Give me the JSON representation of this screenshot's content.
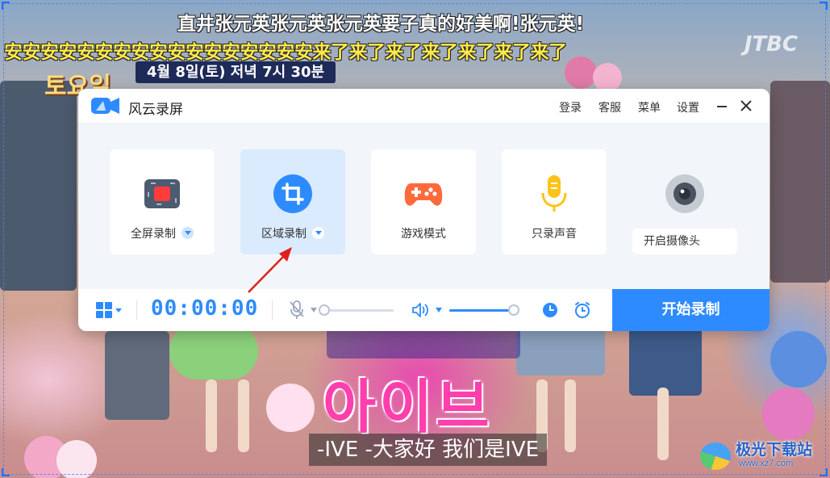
{
  "app": {
    "title": "风云录屏",
    "menu": {
      "login": "登录",
      "service": "客服",
      "menu": "菜单",
      "settings": "设置"
    },
    "modes": [
      {
        "label": "全屏录制",
        "icon": "fullscreen-record-icon",
        "has_dropdown": true,
        "selected": false
      },
      {
        "label": "区域录制",
        "icon": "crop-region-icon",
        "has_dropdown": true,
        "selected": true
      },
      {
        "label": "游戏模式",
        "icon": "gamepad-icon",
        "has_dropdown": false,
        "selected": false
      },
      {
        "label": "只录声音",
        "icon": "microphone-icon",
        "has_dropdown": false,
        "selected": false
      }
    ],
    "camera": {
      "label": "开启摄像头",
      "icon": "camera-icon"
    },
    "toolbar": {
      "timer": "00:00:00",
      "mic_volume": 0,
      "speaker_volume": 1.0,
      "start_label": "开始录制"
    },
    "colors": {
      "accent": "#2e8bff",
      "selected_card": "#d9ebfd",
      "mode_area_bg": "#f2f5fa"
    }
  },
  "background": {
    "danmaku_top": "直井张元英张元英张元英要子真的好美啊!张元英!",
    "danmaku_second": "安安安安安安安安安安安安安安安安安来了来了来了来了来了来了来了",
    "date_banner": "4월 8일(토) 저녁 7시 30분",
    "show_logo": "토요일",
    "korean_title": "아이브",
    "subtitle": "-IVE -大家好 我们是IVE"
  },
  "watermark": {
    "name": "极光下载站",
    "url": "www.xz7.com"
  }
}
